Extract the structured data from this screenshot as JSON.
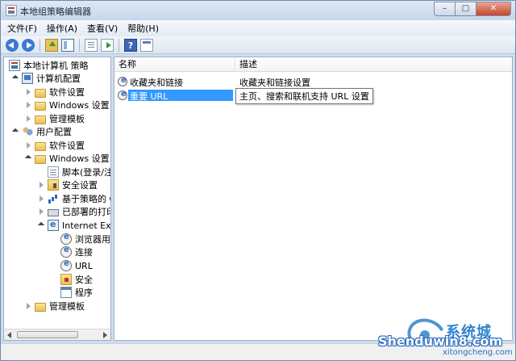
{
  "window": {
    "title": "本地组策略编辑器"
  },
  "caption_buttons": {
    "minimize": "–",
    "maximize": "□",
    "close": "✕"
  },
  "menu": [
    "文件(F)",
    "操作(A)",
    "查看(V)",
    "帮助(H)"
  ],
  "toolbar": {
    "icons": [
      "back-arrow-icon",
      "forward-arrow-icon",
      "up-folder-icon",
      "show-tree-icon",
      "export-list-icon",
      "export-icon",
      "help-icon",
      "properties-icon"
    ],
    "help_glyph": "?"
  },
  "tree": {
    "items": [
      {
        "label": "本地计算机 策略"
      },
      {
        "label": "计算机配置"
      },
      {
        "label": "软件设置"
      },
      {
        "label": "Windows 设置"
      },
      {
        "label": "管理模板"
      },
      {
        "label": "用户配置"
      },
      {
        "label": "软件设置"
      },
      {
        "label": "Windows 设置"
      },
      {
        "label": "脚本(登录/注"
      },
      {
        "label": "安全设置"
      },
      {
        "label": "基于策略的 Q"
      },
      {
        "label": "已部署的打印"
      },
      {
        "label": "Internet Exp"
      },
      {
        "label": "浏览器用户"
      },
      {
        "label": "连接"
      },
      {
        "label": "URL"
      },
      {
        "label": "安全"
      },
      {
        "label": "程序"
      },
      {
        "label": "管理模板"
      }
    ]
  },
  "list": {
    "columns": [
      "名称",
      "描述"
    ],
    "rows": [
      {
        "name": "收藏夹和链接",
        "description": "收藏夹和链接设置"
      },
      {
        "name": "重要 URL",
        "description": "主页、搜索和联机支持 URL 设置"
      }
    ]
  },
  "watermark": {
    "main": "Shenduwin8.com",
    "cn": "系统城",
    "sub": "xitongcheng.com"
  },
  "colors": {
    "selection": "#3399ff",
    "frame": "#cfdcec"
  }
}
